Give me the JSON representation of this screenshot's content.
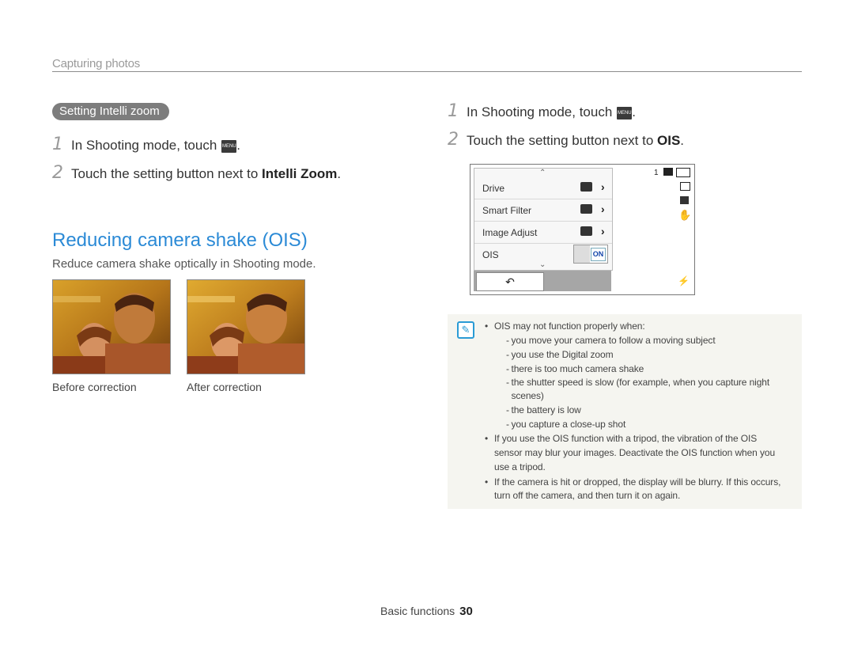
{
  "header": {
    "section": "Capturing photos"
  },
  "left": {
    "pill": "Setting Intelli zoom",
    "steps": [
      {
        "num": "1",
        "text": "In Shooting mode, touch",
        "icon": "MENU",
        "after": "."
      },
      {
        "num": "2",
        "text": "Touch the setting button next to ",
        "bold": "Intelli Zoom",
        "after": "."
      }
    ],
    "heading": "Reducing camera shake (OIS)",
    "subtext": "Reduce camera shake optically in Shooting mode.",
    "captions": [
      "Before correction",
      "After correction"
    ]
  },
  "right": {
    "steps": [
      {
        "num": "1",
        "text": "In Shooting mode, touch",
        "icon": "MENU",
        "after": "."
      },
      {
        "num": "2",
        "text": "Touch the setting button next to ",
        "bold": "OIS",
        "after": "."
      }
    ],
    "screen": {
      "menu": [
        "Drive",
        "Smart Filter",
        "Image Adjust",
        "OIS"
      ],
      "toggle": "ON",
      "counter": "1"
    }
  },
  "note": {
    "b1": "OIS may not function properly when:",
    "dashes": [
      "you move your camera to follow a moving subject",
      "you use the Digital zoom",
      "there is too much camera shake",
      "the shutter speed is slow (for example, when you capture night",
      "scenes)",
      "the battery is low",
      "you capture a close-up shot"
    ],
    "b2": [
      "If you use the OIS function with a tripod, the vibration of the OIS",
      "sensor may blur your images. Deactivate the OIS function when you",
      "use a tripod."
    ],
    "b3": [
      "If the camera is hit or dropped, the display will be blurry. If this occurs,",
      "turn off the camera, and then turn it on again."
    ]
  },
  "footer": {
    "label": "Basic functions",
    "page": "30"
  }
}
